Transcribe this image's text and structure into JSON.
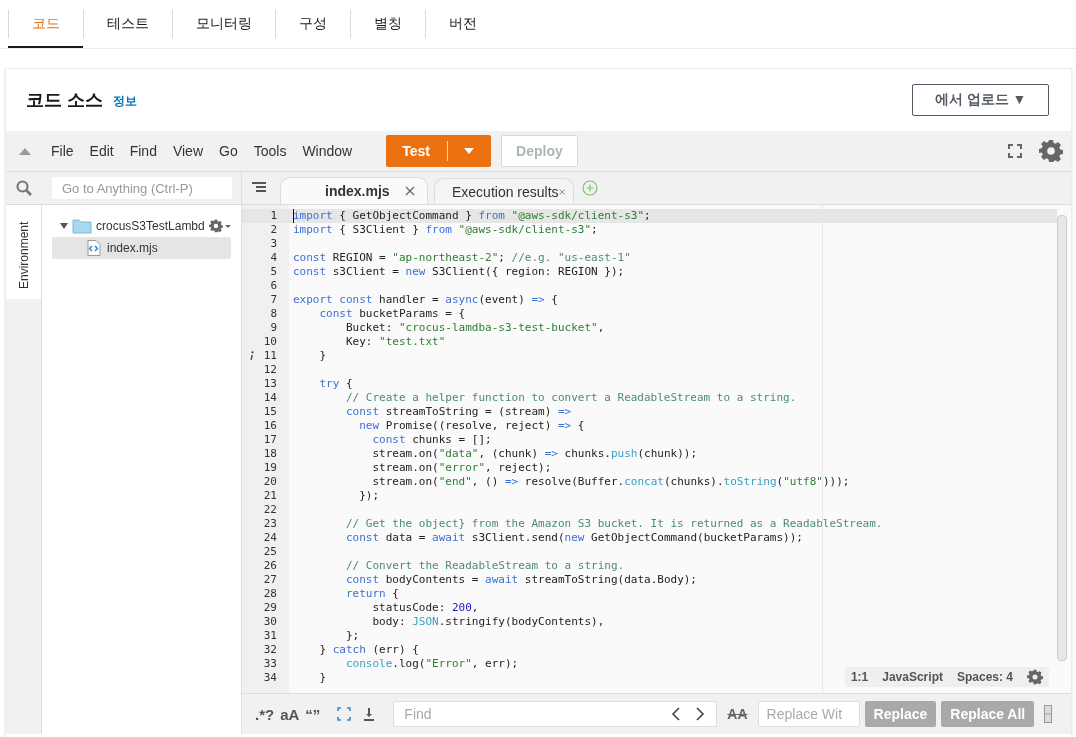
{
  "page_tabs": [
    {
      "label": "코드",
      "selected": true
    },
    {
      "label": "테스트",
      "selected": false
    },
    {
      "label": "모니터링",
      "selected": false
    },
    {
      "label": "구성",
      "selected": false
    },
    {
      "label": "별칭",
      "selected": false
    },
    {
      "label": "버전",
      "selected": false
    }
  ],
  "panel": {
    "title": "코드 소스",
    "info_link": "정보",
    "upload_button": "에서 업로드 ▼"
  },
  "toolbar": {
    "menu": [
      "File",
      "Edit",
      "Find",
      "View",
      "Go",
      "Tools",
      "Window"
    ],
    "test_button": {
      "label": "Test",
      "disabled": false
    },
    "deploy_button": {
      "label": "Deploy",
      "disabled": true
    }
  },
  "sidebar": {
    "search_placeholder": "Go to Anything (Ctrl-P)",
    "side_tabs": [
      {
        "label": "Environment",
        "selected": true
      }
    ],
    "tree": [
      {
        "label": "crocusS3TestLambd",
        "kind": "folder",
        "expanded": true,
        "selected": false,
        "children": [
          {
            "label": "index.mjs",
            "kind": "file",
            "selected": true
          }
        ]
      }
    ]
  },
  "editor": {
    "tabs": [
      {
        "label": "index.mjs",
        "selected": true
      },
      {
        "label": "Execution results",
        "selected": false
      }
    ],
    "lines": [
      {
        "number": "1",
        "current": true,
        "info": false,
        "tokens": [
          {
            "kind": "keyword",
            "text": "import"
          },
          {
            "kind": "plain",
            "text": " { GetObjectCommand } "
          },
          {
            "kind": "keyword",
            "text": "from"
          },
          {
            "kind": "string",
            "text": " \"@aws-sdk/client-s3\""
          },
          {
            "kind": "plain",
            "text": ";"
          }
        ]
      },
      {
        "number": "2",
        "current": false,
        "info": false,
        "tokens": [
          {
            "kind": "keyword",
            "text": "import"
          },
          {
            "kind": "plain",
            "text": " { S3Client } "
          },
          {
            "kind": "keyword",
            "text": "from"
          },
          {
            "kind": "string",
            "text": " \"@aws-sdk/client-s3\""
          },
          {
            "kind": "plain",
            "text": ";"
          }
        ]
      },
      {
        "number": "3",
        "current": false,
        "info": false
      },
      {
        "number": "4",
        "current": false,
        "info": false,
        "tokens": [
          {
            "kind": "keyword",
            "text": "const"
          },
          {
            "kind": "plain",
            "text": " REGION = "
          },
          {
            "kind": "string",
            "text": "\"ap-northeast-2\""
          },
          {
            "kind": "plain",
            "text": "; "
          },
          {
            "kind": "comment",
            "text": "//e.g. \"us-east-1\""
          }
        ]
      },
      {
        "number": "5",
        "current": false,
        "info": false,
        "tokens": [
          {
            "kind": "keyword",
            "text": "const"
          },
          {
            "kind": "plain",
            "text": " s3Client = "
          },
          {
            "kind": "keyword",
            "text": "new"
          },
          {
            "kind": "plain",
            "text": " S3Client({ region: REGION });"
          }
        ]
      },
      {
        "number": "6",
        "current": false,
        "info": false
      },
      {
        "number": "7",
        "current": false,
        "info": false,
        "tokens": [
          {
            "kind": "keyword",
            "text": "export const"
          },
          {
            "kind": "plain",
            "text": " handler = "
          },
          {
            "kind": "keyword",
            "text": "async"
          },
          {
            "kind": "plain",
            "text": "(event) "
          },
          {
            "kind": "keyword",
            "text": "=>"
          },
          {
            "kind": "plain",
            "text": " {"
          }
        ]
      },
      {
        "number": "8",
        "current": false,
        "info": false,
        "tokens": [
          {
            "kind": "keyword",
            "text": "    const"
          },
          {
            "kind": "plain",
            "text": " bucketParams = {"
          }
        ]
      },
      {
        "number": "9",
        "current": false,
        "info": false,
        "tokens": [
          {
            "kind": "plain",
            "text": "        Bucket: "
          },
          {
            "kind": "string",
            "text": "\"crocus-lamdba-s3-test-bucket\""
          },
          {
            "kind": "plain",
            "text": ","
          }
        ]
      },
      {
        "number": "10",
        "current": false,
        "info": false,
        "tokens": [
          {
            "kind": "plain",
            "text": "        Key: "
          },
          {
            "kind": "string",
            "text": "\"test.txt\""
          }
        ]
      },
      {
        "number": "11",
        "current": false,
        "info": true,
        "tokens": [
          {
            "kind": "plain",
            "text": "    }"
          }
        ]
      },
      {
        "number": "12",
        "current": false,
        "info": false
      },
      {
        "number": "13",
        "current": false,
        "info": false,
        "tokens": [
          {
            "kind": "keyword",
            "text": "    try"
          },
          {
            "kind": "plain",
            "text": " {"
          }
        ]
      },
      {
        "number": "14",
        "current": false,
        "info": false,
        "tokens": [
          {
            "kind": "comment",
            "text": "        // Create a helper function to convert a ReadableStream to a string."
          }
        ]
      },
      {
        "number": "15",
        "current": false,
        "info": false,
        "tokens": [
          {
            "kind": "keyword",
            "text": "        const"
          },
          {
            "kind": "plain",
            "text": " streamToString = (stream) "
          },
          {
            "kind": "keyword",
            "text": "=>"
          }
        ]
      },
      {
        "number": "16",
        "current": false,
        "info": false,
        "tokens": [
          {
            "kind": "keyword",
            "text": "          new"
          },
          {
            "kind": "plain",
            "text": " Promise((resolve, reject) "
          },
          {
            "kind": "keyword",
            "text": "=>"
          },
          {
            "kind": "plain",
            "text": " {"
          }
        ]
      },
      {
        "number": "17",
        "current": false,
        "info": false,
        "tokens": [
          {
            "kind": "keyword",
            "text": "            const"
          },
          {
            "kind": "plain",
            "text": " chunks = [];"
          }
        ]
      },
      {
        "number": "18",
        "current": false,
        "info": false,
        "tokens": [
          {
            "kind": "plain",
            "text": "            stream.on("
          },
          {
            "kind": "string",
            "text": "\"data\""
          },
          {
            "kind": "plain",
            "text": ", (chunk) "
          },
          {
            "kind": "keyword",
            "text": "=>"
          },
          {
            "kind": "plain",
            "text": " chunks."
          },
          {
            "kind": "builtin",
            "text": "push"
          },
          {
            "kind": "plain",
            "text": "(chunk));"
          }
        ]
      },
      {
        "number": "19",
        "current": false,
        "info": false,
        "tokens": [
          {
            "kind": "plain",
            "text": "            stream.on("
          },
          {
            "kind": "string",
            "text": "\"error\""
          },
          {
            "kind": "plain",
            "text": ", reject);"
          }
        ]
      },
      {
        "number": "20",
        "current": false,
        "info": false,
        "tokens": [
          {
            "kind": "plain",
            "text": "            stream.on("
          },
          {
            "kind": "string",
            "text": "\"end\""
          },
          {
            "kind": "plain",
            "text": ", () "
          },
          {
            "kind": "keyword",
            "text": "=>"
          },
          {
            "kind": "plain",
            "text": " resolve(Buffer."
          },
          {
            "kind": "builtin",
            "text": "concat"
          },
          {
            "kind": "plain",
            "text": "(chunks)."
          },
          {
            "kind": "builtin",
            "text": "toString"
          },
          {
            "kind": "plain",
            "text": "("
          },
          {
            "kind": "string",
            "text": "\"utf8\""
          },
          {
            "kind": "plain",
            "text": ")));"
          }
        ]
      },
      {
        "number": "21",
        "current": false,
        "info": false,
        "tokens": [
          {
            "kind": "plain",
            "text": "          });"
          }
        ]
      },
      {
        "number": "22",
        "current": false,
        "info": false
      },
      {
        "number": "23",
        "current": false,
        "info": false,
        "tokens": [
          {
            "kind": "comment",
            "text": "        // Get the object} from the Amazon S3 bucket. It is returned as a ReadableStream."
          }
        ]
      },
      {
        "number": "24",
        "current": false,
        "info": false,
        "tokens": [
          {
            "kind": "keyword",
            "text": "        const"
          },
          {
            "kind": "plain",
            "text": " data = "
          },
          {
            "kind": "keyword",
            "text": "await"
          },
          {
            "kind": "plain",
            "text": " s3Client.send("
          },
          {
            "kind": "keyword",
            "text": "new"
          },
          {
            "kind": "plain",
            "text": " GetObjectCommand(bucketParams));"
          }
        ]
      },
      {
        "number": "25",
        "current": false,
        "info": false
      },
      {
        "number": "26",
        "current": false,
        "info": false,
        "tokens": [
          {
            "kind": "comment",
            "text": "        // Convert the ReadableStream to a string."
          }
        ]
      },
      {
        "number": "27",
        "current": false,
        "info": false,
        "tokens": [
          {
            "kind": "keyword",
            "text": "        const"
          },
          {
            "kind": "plain",
            "text": " bodyContents = "
          },
          {
            "kind": "keyword",
            "text": "await"
          },
          {
            "kind": "plain",
            "text": " streamToString(data.Body);"
          }
        ]
      },
      {
        "number": "28",
        "current": false,
        "info": false,
        "tokens": [
          {
            "kind": "keyword",
            "text": "        return"
          },
          {
            "kind": "plain",
            "text": " {"
          }
        ]
      },
      {
        "number": "29",
        "current": false,
        "info": false,
        "tokens": [
          {
            "kind": "plain",
            "text": "            statusCode: "
          },
          {
            "kind": "number",
            "text": "200"
          },
          {
            "kind": "plain",
            "text": ","
          }
        ]
      },
      {
        "number": "30",
        "current": false,
        "info": false,
        "tokens": [
          {
            "kind": "plain",
            "text": "            body: "
          },
          {
            "kind": "builtin",
            "text": "JSON"
          },
          {
            "kind": "plain",
            "text": ".stringify(bodyContents),"
          }
        ]
      },
      {
        "number": "31",
        "current": false,
        "info": false,
        "tokens": [
          {
            "kind": "plain",
            "text": "        };"
          }
        ]
      },
      {
        "number": "32",
        "current": false,
        "info": false,
        "tokens": [
          {
            "kind": "plain",
            "text": "    } "
          },
          {
            "kind": "keyword",
            "text": "catch"
          },
          {
            "kind": "plain",
            "text": " (err) {"
          }
        ]
      },
      {
        "number": "33",
        "current": false,
        "info": false,
        "tokens": [
          {
            "kind": "builtin",
            "text": "        console"
          },
          {
            "kind": "plain",
            "text": ".log("
          },
          {
            "kind": "string",
            "text": "\"Error\""
          },
          {
            "kind": "plain",
            "text": ", err);"
          }
        ]
      },
      {
        "number": "34",
        "current": false,
        "info": false,
        "tokens": [
          {
            "kind": "plain",
            "text": "    }"
          }
        ]
      }
    ],
    "status": [
      "1:1",
      "JavaScript",
      "Spaces: 4"
    ]
  },
  "find_bar": {
    "toggles": [
      ".*?",
      "aA",
      "“”"
    ],
    "find_placeholder": "Find",
    "preserve_case": "AA",
    "replace_placeholder": "Replace Wit",
    "buttons": [
      "Replace",
      "Replace All"
    ]
  }
}
